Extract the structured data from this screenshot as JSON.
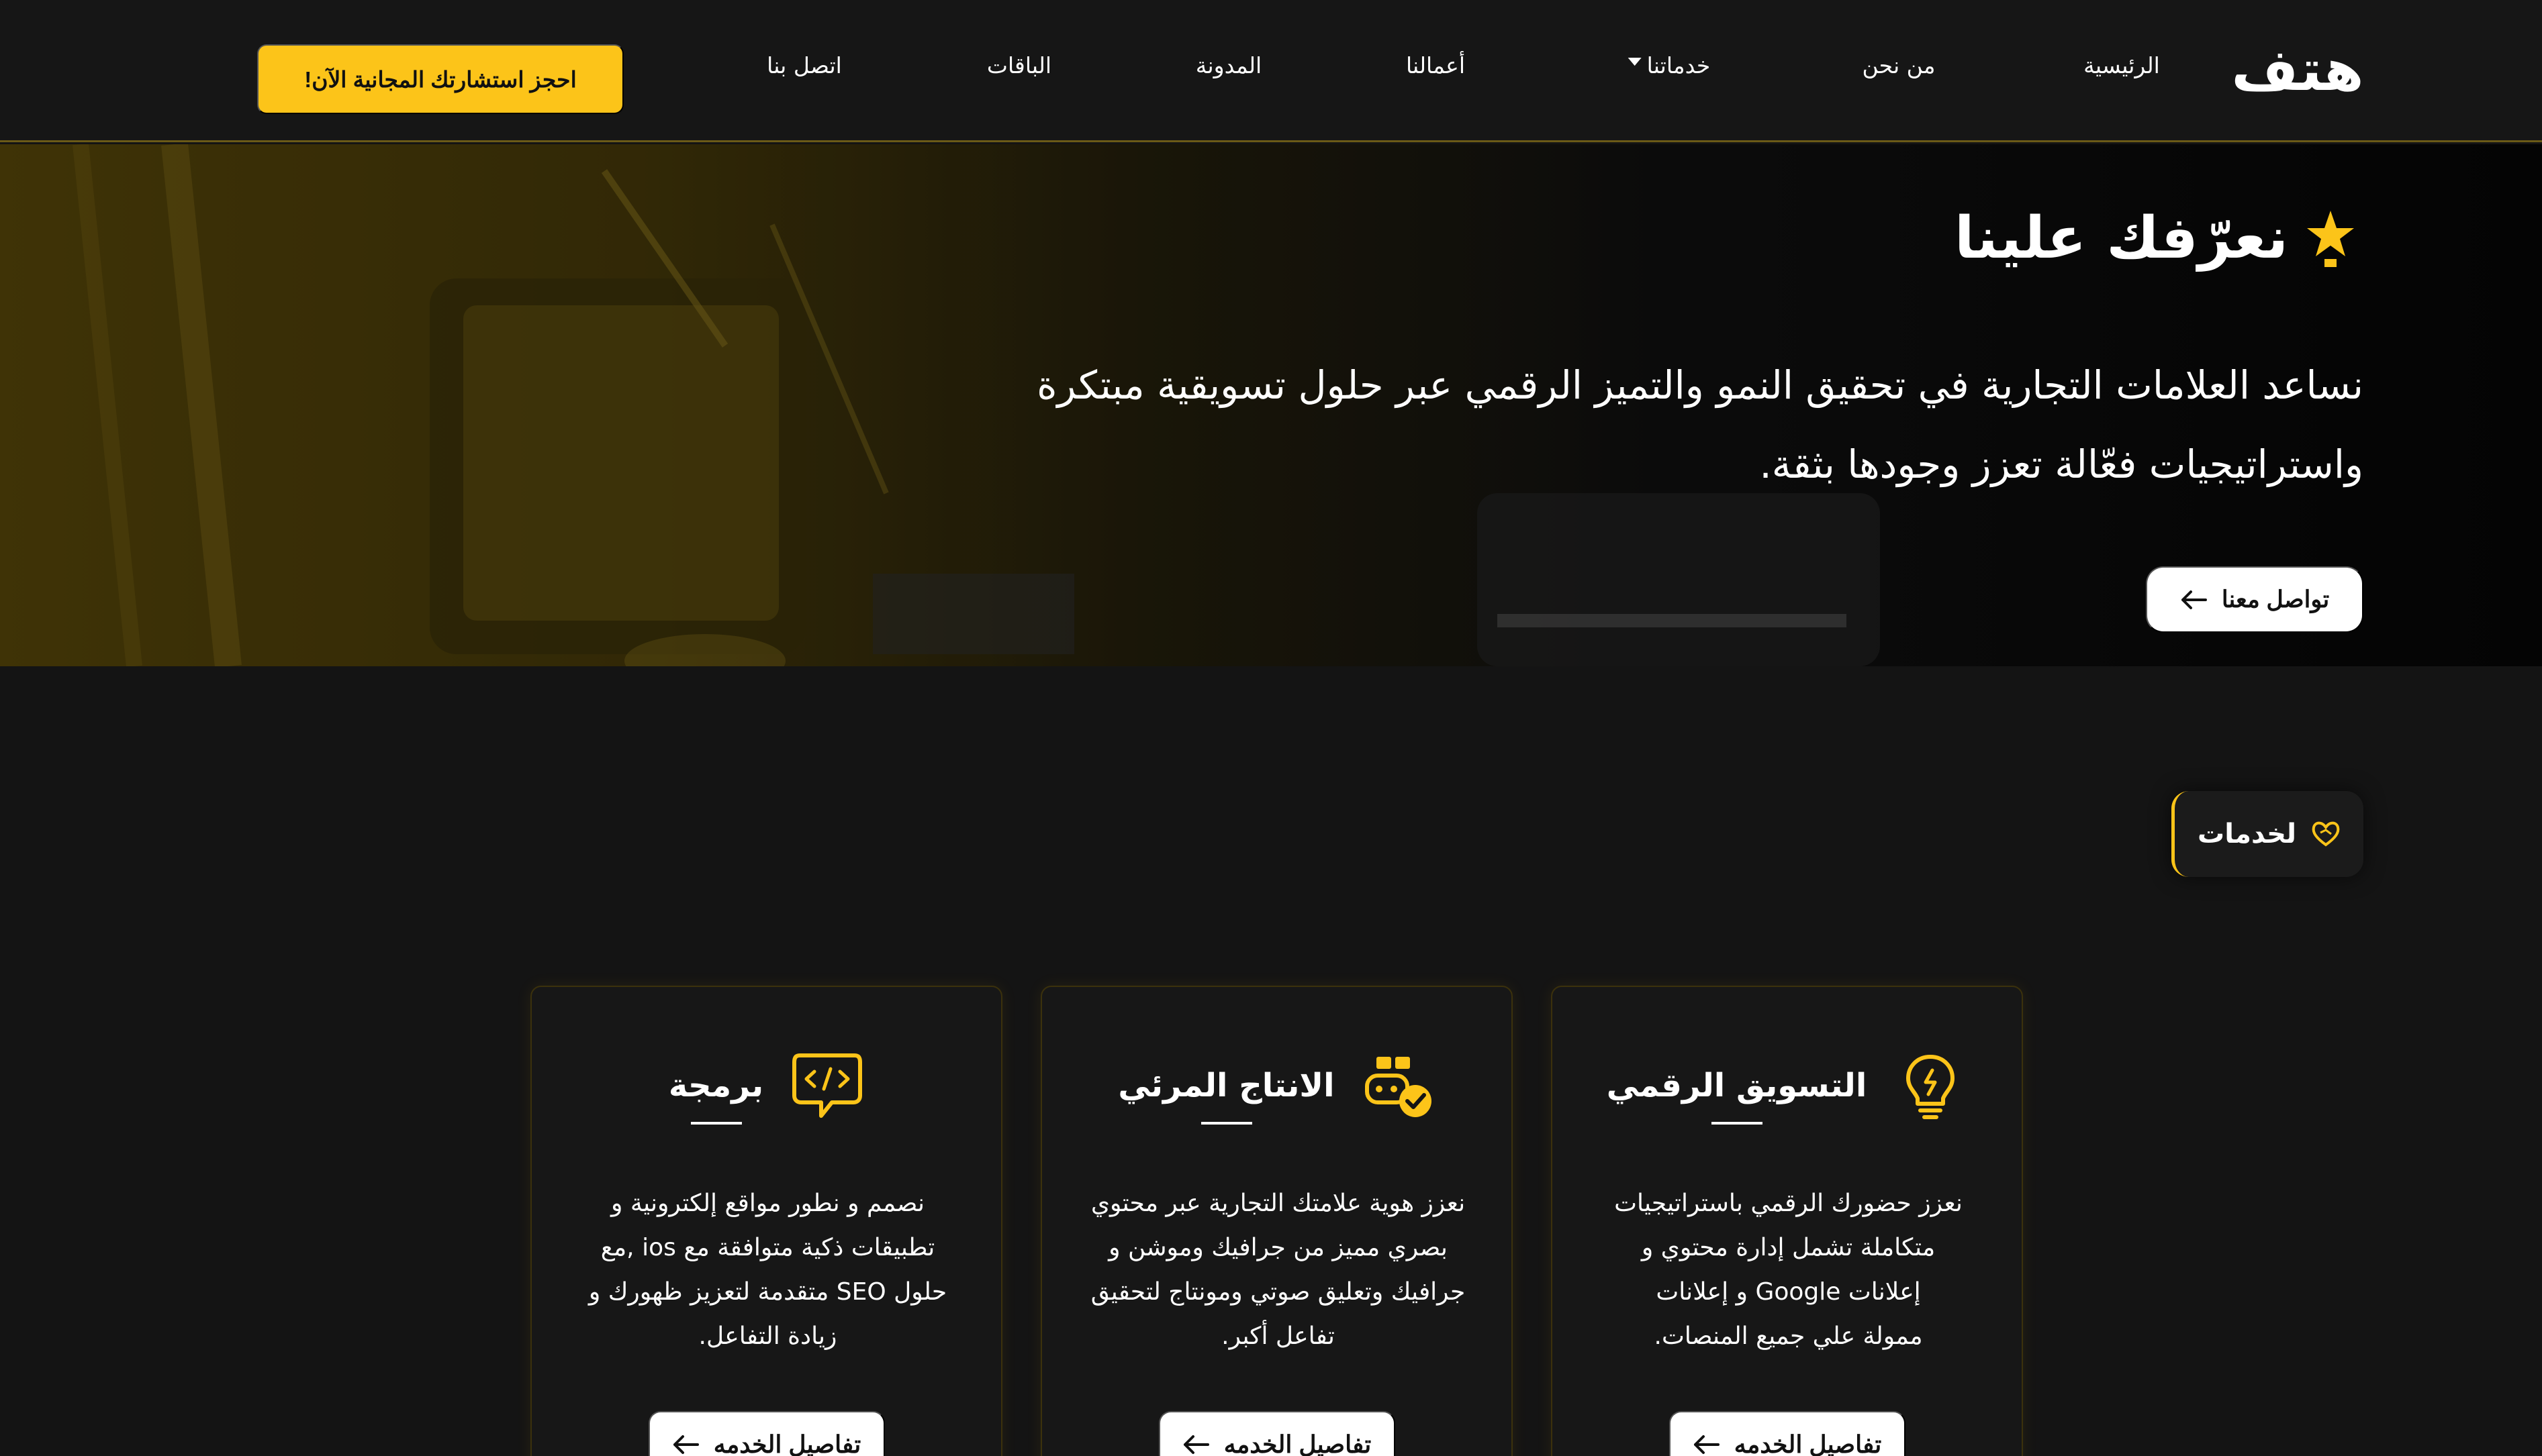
{
  "nav": {
    "logo_text": "هتف",
    "links": [
      "الرئيسية",
      "من نحن",
      "خدماتنا",
      "أعمالنا",
      "المدونة",
      "الباقات",
      "اتصل بنا"
    ],
    "cta": "احجز استشارتك المجانية الآن!"
  },
  "hero": {
    "title": "نعرّفك علينا",
    "description_line1": "نساعد العلامات التجارية في تحقيق النمو والتميز الرقمي عبر حلول تسويقية مبتكرة",
    "description_line2": "واستراتيجيات فعّالة تعزز وجودها بثقة.",
    "button": "تواصل معنا"
  },
  "section": {
    "badge": "لخدمات"
  },
  "services": [
    {
      "title": "التسويق الرقمي",
      "icon": "lightbulb-icon",
      "desc_lines": [
        "نعزز حضورك الرقمي باستراتيجيات",
        "متكاملة تشمل إدارة محتوي و",
        "إعلانات Google و إعلانات",
        "ممولة علي جميع المنصات."
      ],
      "button": "تفاصيل الخدمه"
    },
    {
      "title": "الانتاج المرئي",
      "icon": "media-production-icon",
      "desc_lines": [
        "نعزز هوية علامتك التجارية عبر محتوي",
        "بصري مميز من جرافيك وموشن و",
        "جرافيك وتعليق صوتي ومونتاج لتحقيق",
        "تفاعل أكبر."
      ],
      "button": "تفاصيل الخدمه"
    },
    {
      "title": "برمجة",
      "icon": "code-chat-icon",
      "desc_lines": [
        "نصمم و نطور مواقع إلكترونية و",
        "تطبيقات ذكية متوافقة مع ios ,مع",
        "حلول SEO متقدمة لتعزيز ظهورك و",
        "زيادة التفاعل."
      ],
      "button": "تفاصيل الخدمه"
    }
  ],
  "colors": {
    "accent": "#fcc419",
    "background": "#141414",
    "card_border": "#3b310c"
  }
}
